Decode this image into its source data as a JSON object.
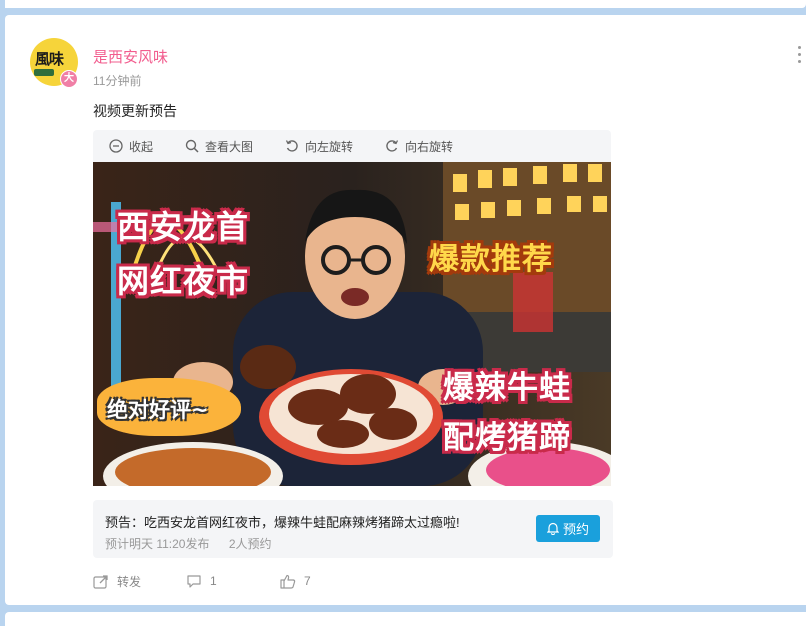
{
  "post": {
    "author": "是西安风味",
    "avatar_badge": "大",
    "avatar_logo": "風味",
    "time": "11分钟前",
    "text": "视频更新预告",
    "more_icon": "more-vertical-icon"
  },
  "toolbar": {
    "collapse": "收起",
    "view_large": "查看大图",
    "rotate_left": "向左旋转",
    "rotate_right": "向右旋转"
  },
  "image_captions": {
    "line1": "西安龙首",
    "line2": "网红夜市",
    "hot": "爆款推荐",
    "bubble": "绝对好评~",
    "dish1": "爆辣牛蛙",
    "dish2": "配烤猪蹄"
  },
  "preview": {
    "title": "预告：吃西安龙首网红夜市，爆辣牛蛙配麻辣烤猪蹄太过瘾啦!",
    "schedule": "预计明天 11:20发布",
    "reservations": "2人预约",
    "reserve_button": "预约"
  },
  "actions": {
    "forward": "转发",
    "comments": "1",
    "likes": "7"
  },
  "colors": {
    "author": "#f25d8e",
    "accent": "#1aa0dc",
    "background": "#b9d4ef"
  }
}
